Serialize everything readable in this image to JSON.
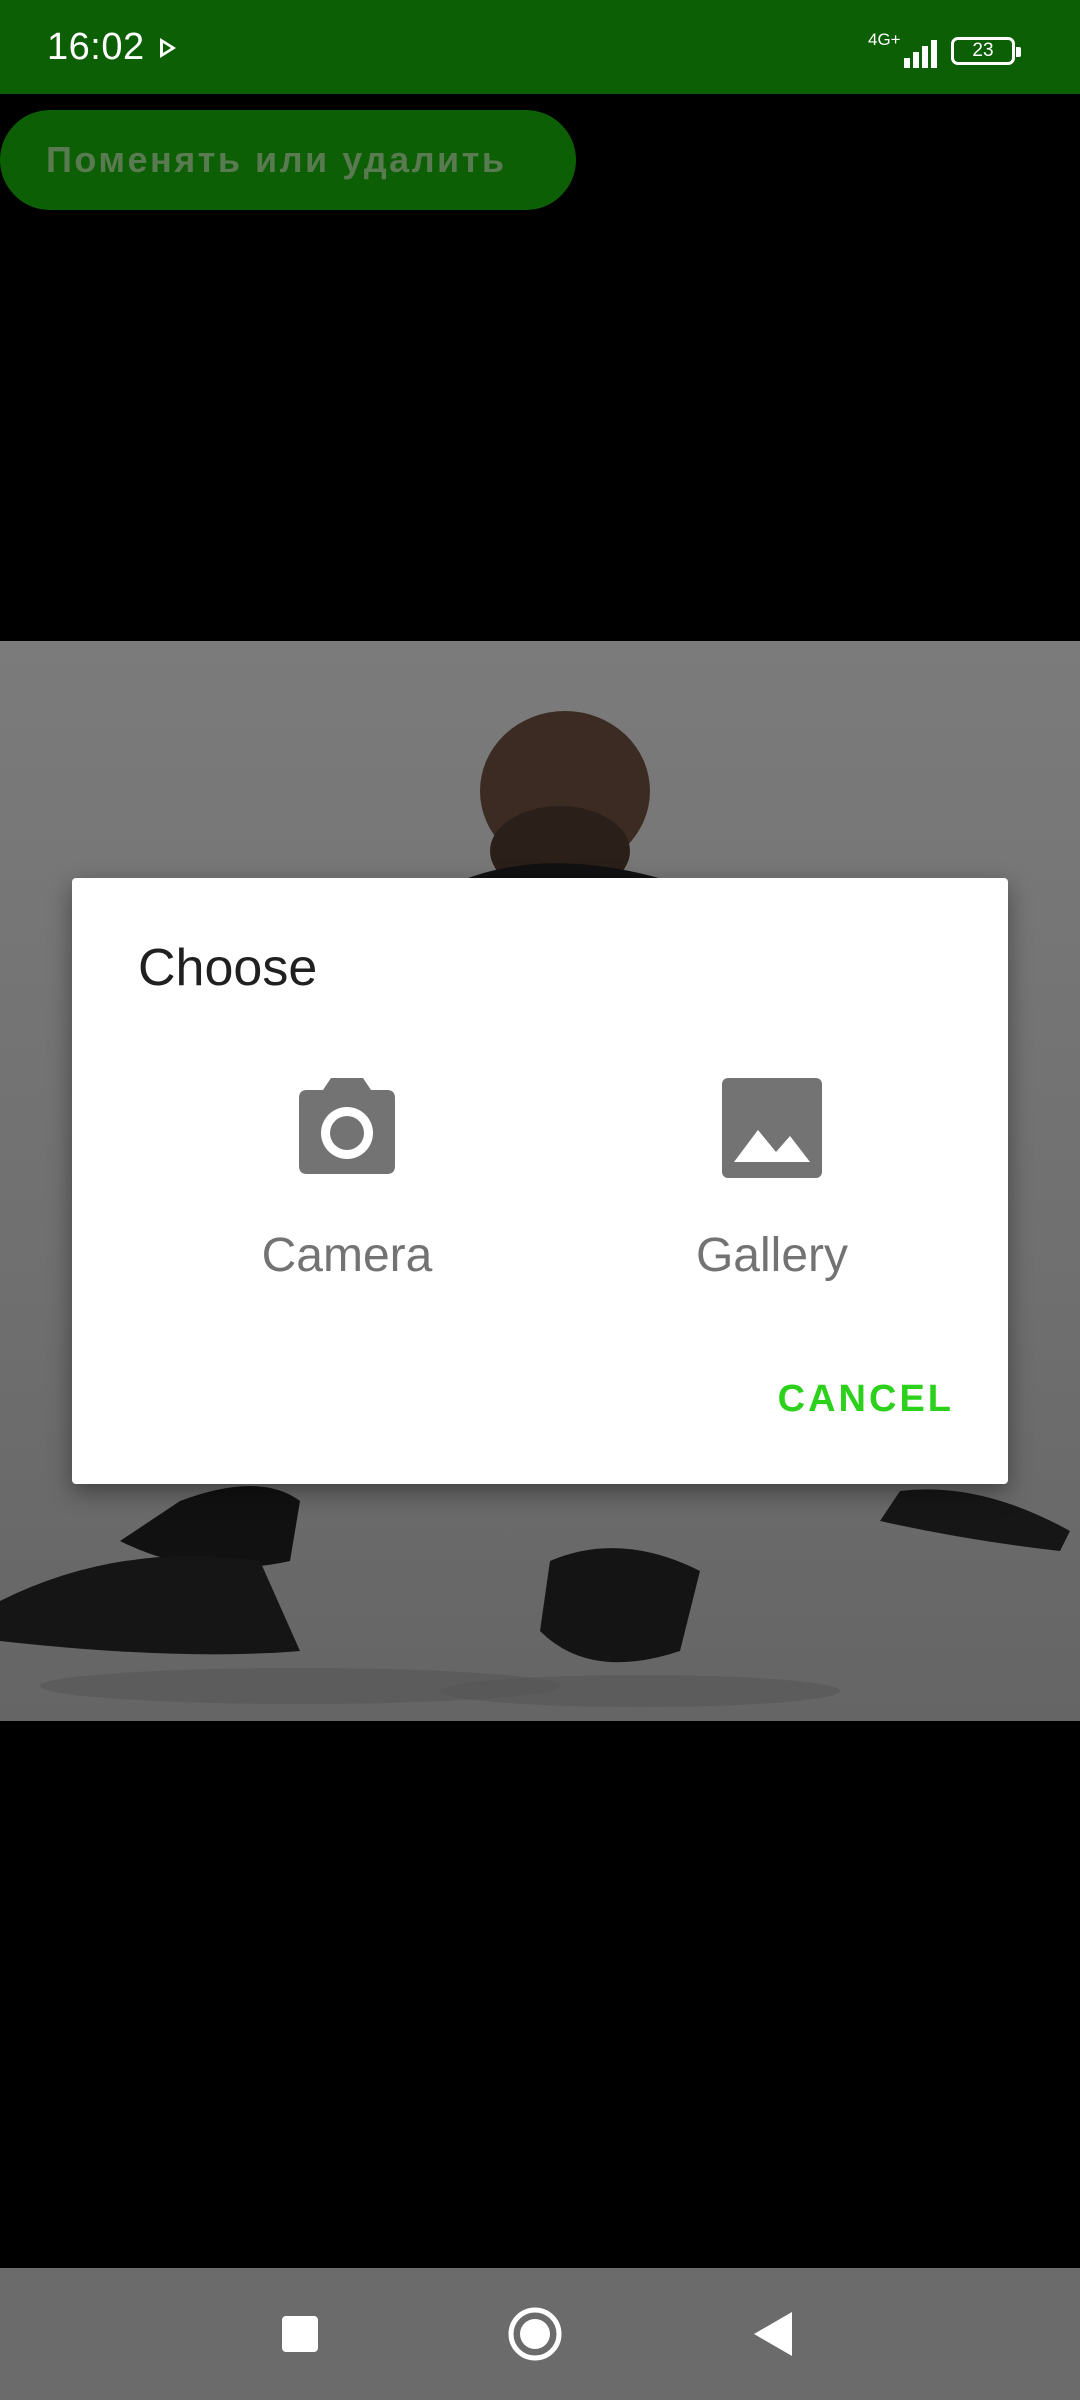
{
  "status_bar": {
    "time": "16:02",
    "network": "4G+",
    "battery": "23",
    "bg_color": "#0d5f06"
  },
  "action_button": {
    "label": "Поменять или удалить",
    "color": "#0d5f06"
  },
  "dialog": {
    "title": "Choose",
    "options": [
      {
        "label": "Camera",
        "icon": "camera-icon"
      },
      {
        "label": "Gallery",
        "icon": "image-icon"
      }
    ],
    "cancel_label": "CANCEL",
    "accent_color": "#2bd11a"
  },
  "nav_bar": {
    "buttons": [
      "recent-apps-square-icon",
      "home-circle-icon",
      "back-triangle-icon"
    ]
  }
}
